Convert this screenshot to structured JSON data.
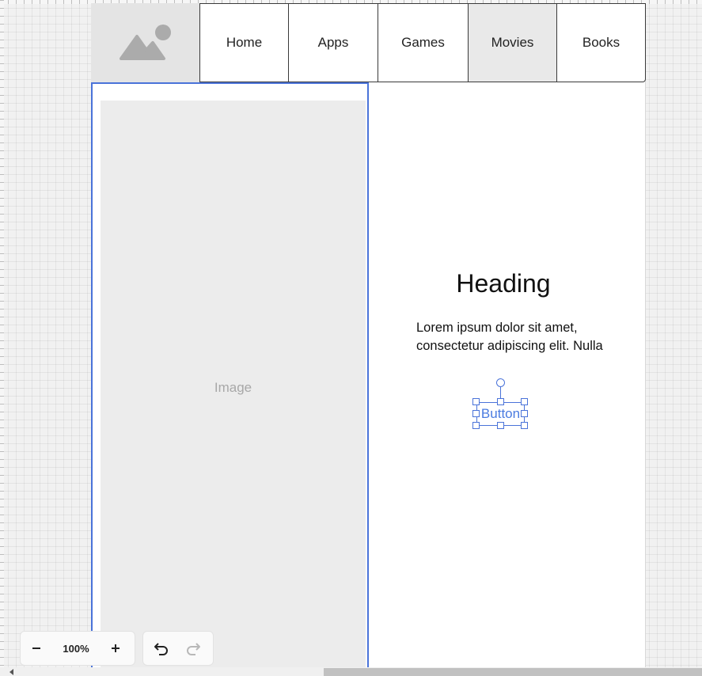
{
  "nav": {
    "items": [
      {
        "label": "Home"
      },
      {
        "label": "Apps"
      },
      {
        "label": "Games"
      },
      {
        "label": "Movies",
        "active": true
      },
      {
        "label": "Books"
      }
    ]
  },
  "image_panel": {
    "placeholder_label": "Image"
  },
  "content": {
    "heading": "Heading",
    "body_line1": "Lorem ipsum dolor sit amet,",
    "body_line2": "consectetur adipiscing elit. Nulla",
    "button_label": "Button"
  },
  "toolbar": {
    "zoom_level": "100%",
    "zoom_out_icon": "minus-icon",
    "zoom_in_icon": "plus-icon",
    "undo_icon": "undo-icon",
    "redo_icon": "redo-icon"
  },
  "colors": {
    "selection": "#4a73d9",
    "button_text": "#4a7be0",
    "placeholder_bg": "#ececec",
    "active_nav_bg": "#e9e9e9"
  }
}
